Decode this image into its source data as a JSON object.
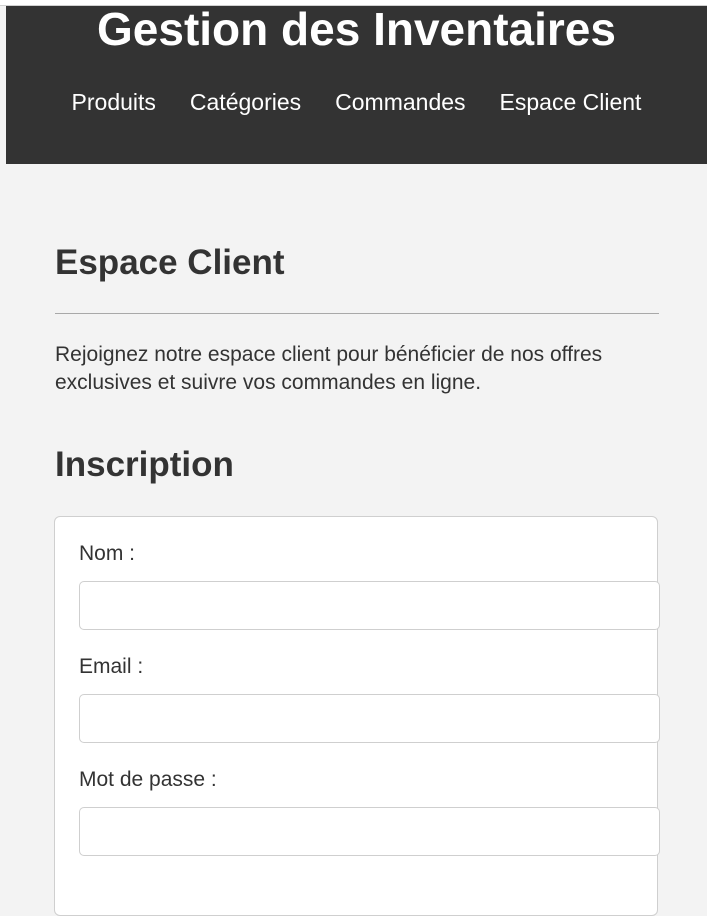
{
  "header": {
    "title": "Gestion des Inventaires",
    "nav": [
      {
        "label": "Produits"
      },
      {
        "label": "Catégories"
      },
      {
        "label": "Commandes"
      },
      {
        "label": "Espace Client"
      }
    ]
  },
  "main": {
    "section_title": "Espace Client",
    "intro": "Rejoignez notre espace client pour bénéficier de nos offres exclusives et suivre vos commandes en ligne.",
    "form": {
      "title": "Inscription",
      "fields": [
        {
          "label": "Nom :",
          "value": "",
          "placeholder": ""
        },
        {
          "label": "Email :",
          "value": "",
          "placeholder": ""
        },
        {
          "label": "Mot de passe :",
          "value": "",
          "placeholder": ""
        }
      ]
    }
  },
  "colors": {
    "header_bg": "#333333",
    "page_bg": "#f3f3f3",
    "text": "#333333"
  }
}
